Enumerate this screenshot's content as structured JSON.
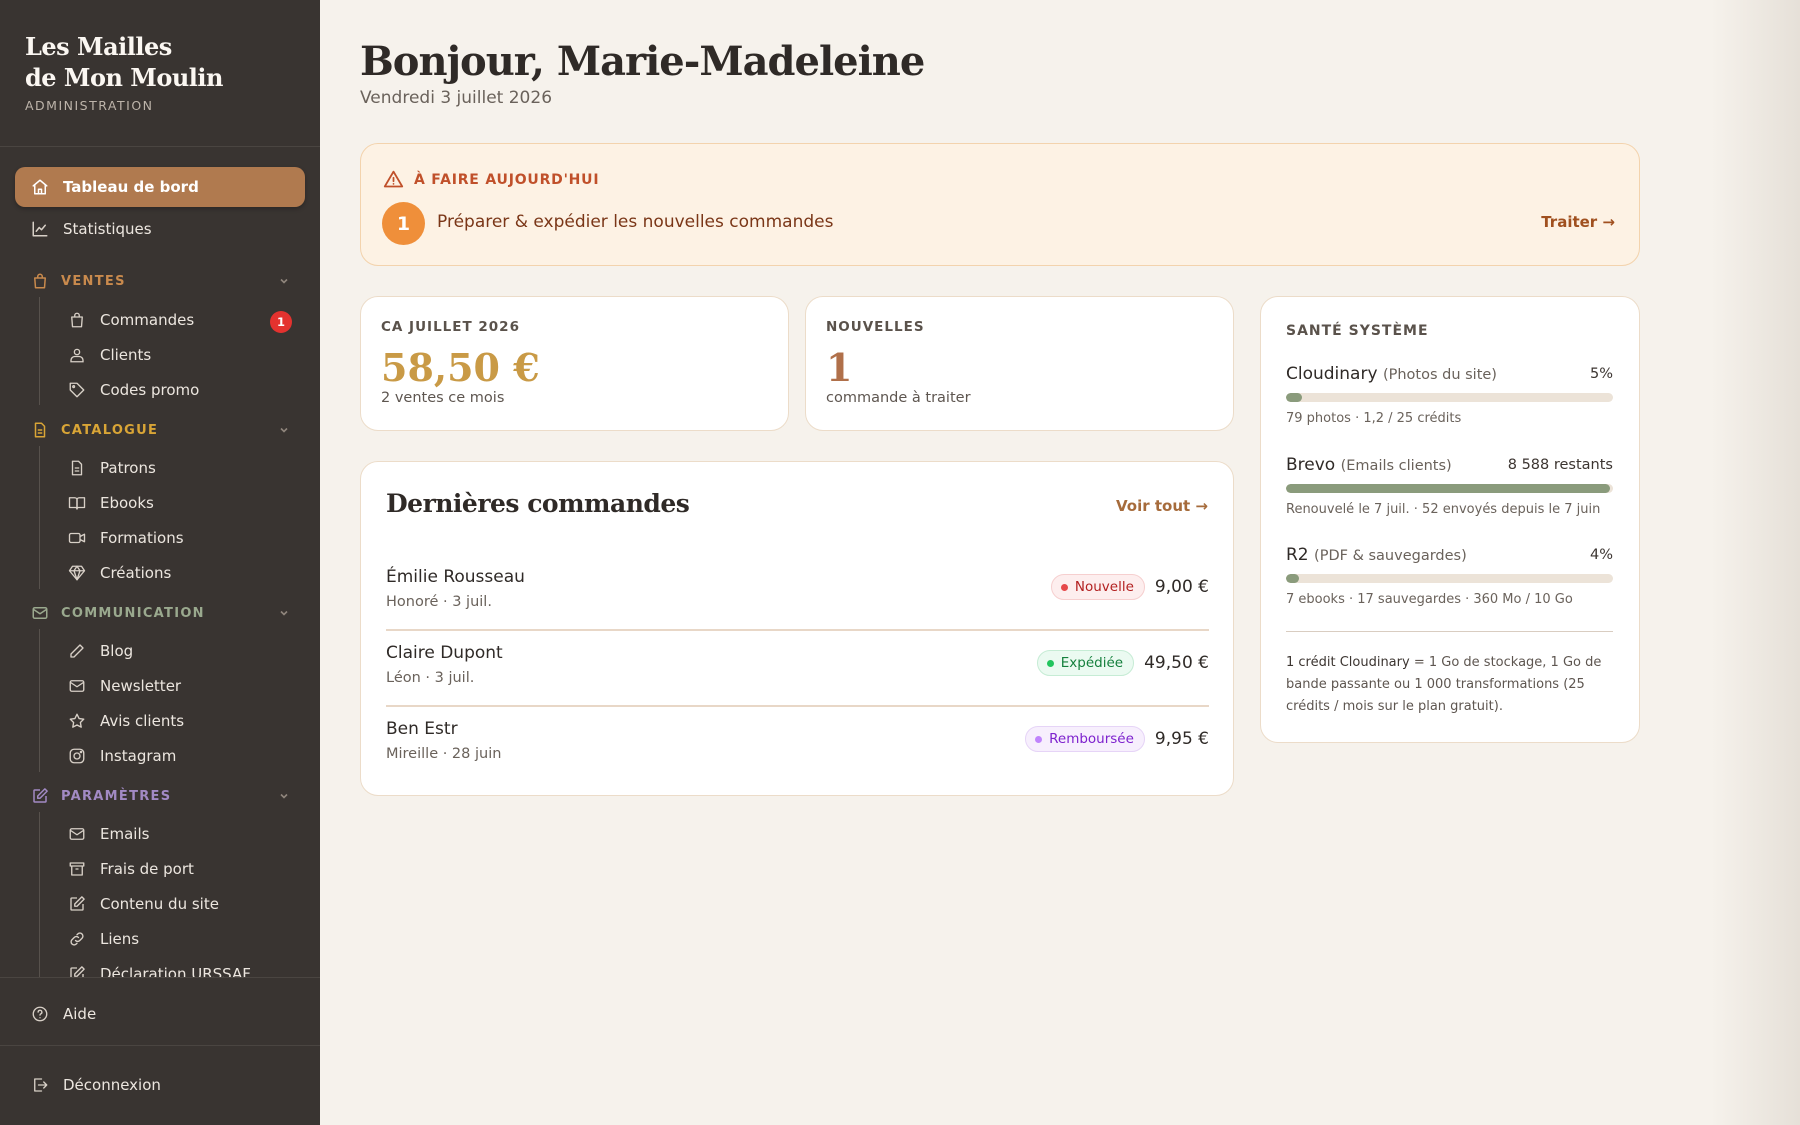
{
  "brand": {
    "line1": "Les Mailles",
    "line2": "de Mon Moulin",
    "subtitle": "ADMINISTRATION"
  },
  "nav": {
    "dashboard": "Tableau de bord",
    "stats": "Statistiques",
    "sections": {
      "ventes": {
        "label": "VENTES",
        "color": "#c98a4d",
        "items": [
          "Commandes",
          "Clients",
          "Codes promo"
        ]
      },
      "catalogue": {
        "label": "CATALOGUE",
        "color": "#d9a536",
        "items": [
          "Patrons",
          "Ebooks",
          "Formations",
          "Créations"
        ]
      },
      "communication": {
        "label": "COMMUNICATION",
        "color": "#9aa98e",
        "items": [
          "Blog",
          "Newsletter",
          "Avis clients",
          "Instagram"
        ]
      },
      "parametres": {
        "label": "PARAMÈTRES",
        "color": "#a28ac4",
        "items": [
          "Emails",
          "Frais de port",
          "Contenu du site",
          "Liens",
          "Déclaration URSSAF"
        ]
      }
    },
    "orders_badge": "1",
    "help": "Aide",
    "logout": "Déconnexion"
  },
  "header": {
    "greeting": "Bonjour, Marie-Madeleine",
    "date": "Vendredi 3 juillet 2026"
  },
  "todo": {
    "heading": "À FAIRE AUJOURD'HUI",
    "count": "1",
    "text": "Préparer & expédier les nouvelles commandes",
    "action": "Traiter →"
  },
  "stats": {
    "revenue": {
      "label": "CA JUILLET 2026",
      "value": "58,50 €",
      "sub": "2 ventes ce mois",
      "color": "#c99a46"
    },
    "new_orders": {
      "label": "NOUVELLES",
      "value": "1",
      "sub": "commande à traiter",
      "color": "#b0704a"
    }
  },
  "orders": {
    "title": "Dernières commandes",
    "link": "Voir tout →",
    "rows": [
      {
        "name": "Émilie Rousseau",
        "meta": "Honoré · 3 juil.",
        "status": "Nouvelle",
        "amount": "9,00 €"
      },
      {
        "name": "Claire Dupont",
        "meta": "Léon · 3 juil.",
        "status": "Expédiée",
        "amount": "49,50 €"
      },
      {
        "name": "Ben Estr",
        "meta": "Mireille · 28 juin",
        "status": "Remboursée",
        "amount": "9,95 €"
      }
    ]
  },
  "health": {
    "title": "SANTÉ SYSTÈME",
    "services": [
      {
        "name": "Cloudinary",
        "desc": "(Photos du site)",
        "value": "5%",
        "usage": 0.05,
        "meta": "79 photos · 1,2 / 25 crédits"
      },
      {
        "name": "Brevo",
        "desc": "(Emails clients)",
        "value": "8 588 restants",
        "usage": 0.99,
        "meta": "Renouvelé le 7 juil. · 52 envoyés depuis le 7 juin"
      },
      {
        "name": "R2",
        "desc": "(PDF & sauvegardes)",
        "value": "4%",
        "usage": 0.04,
        "meta": "7 ebooks · 17 sauvegardes · 360 Mo / 10 Go"
      }
    ],
    "note_bold": "1 crédit Cloudinary",
    "note_rest": " = 1 Go de stockage, 1 Go de bande passante ou 1 000 transformations (25 crédits / mois sur le plan gratuit)."
  }
}
